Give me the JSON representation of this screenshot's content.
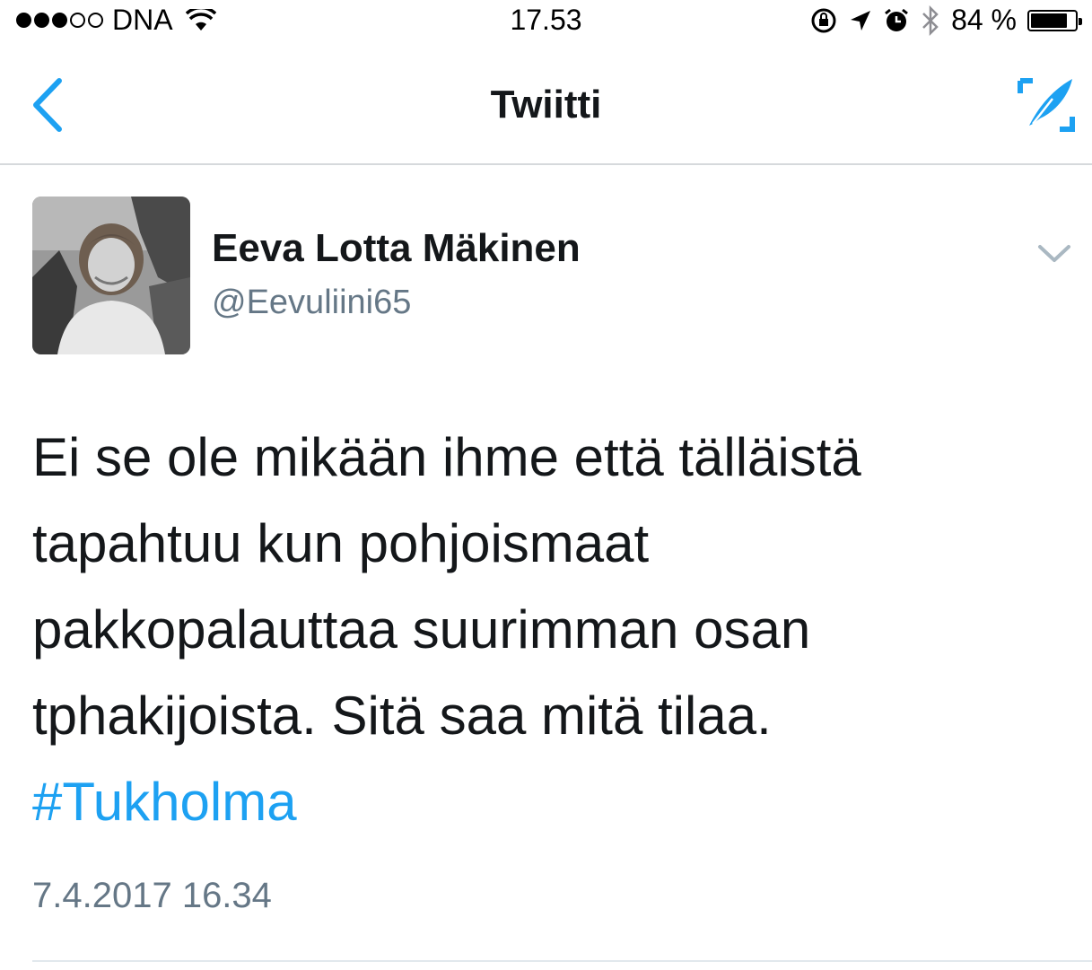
{
  "status_bar": {
    "carrier": "DNA",
    "time": "17.53",
    "battery_percent": "84 %",
    "battery_level": 0.84
  },
  "nav": {
    "title": "Twiitti",
    "back_icon": "chevron-left-icon",
    "compose_icon": "compose-tweet-icon",
    "accent_color": "#1da1f2"
  },
  "tweet": {
    "author_name": "Eeva Lotta Mäkinen",
    "author_handle": "@Eevuliini65",
    "text_lines": [
      "Ei se ole mikään ihme että tälläistä",
      "tapahtuu kun pohjoismaat",
      "pakkopalauttaa suurimman osan",
      "tphakijoista. Sitä saa mitä tilaa."
    ],
    "hashtag": "#Tukholma",
    "timestamp": "7.4.2017 16.34"
  }
}
